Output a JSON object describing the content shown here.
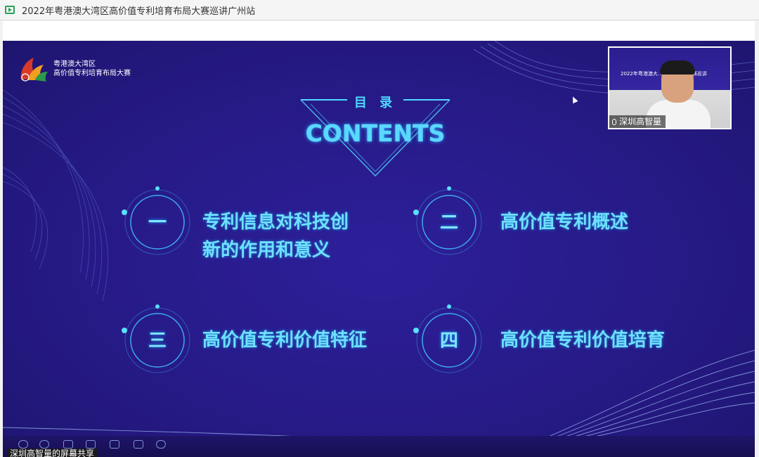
{
  "window": {
    "title": "2022年粤港澳大湾区高价值专利培育布局大赛巡讲广州站"
  },
  "slide": {
    "logo_line1": "粤港澳大湾区",
    "logo_line2": "高价值专利培育布局大赛",
    "toc_heading": "目 录",
    "contents_label": "CONTENTS",
    "items": [
      {
        "num": "一",
        "label_line1": "专利信息对科技创",
        "label_line2": "新的作用和意义"
      },
      {
        "num": "二",
        "label_line1": "高价值专利概述",
        "label_line2": ""
      },
      {
        "num": "三",
        "label_line1": "高价值专利价值特征",
        "label_line2": ""
      },
      {
        "num": "四",
        "label_line1": "高价值专利价值培育",
        "label_line2": ""
      }
    ]
  },
  "video": {
    "speaker_name": "深圳高智量",
    "slide_title": "2022年粤港澳大…利培育布局大赛巡讲"
  },
  "share": {
    "label": "深圳高智量的屏幕共享"
  },
  "colors": {
    "slide_bg": "#261a86",
    "accent": "#5ad8ff",
    "titlebar_icon": "#2aa05a"
  }
}
